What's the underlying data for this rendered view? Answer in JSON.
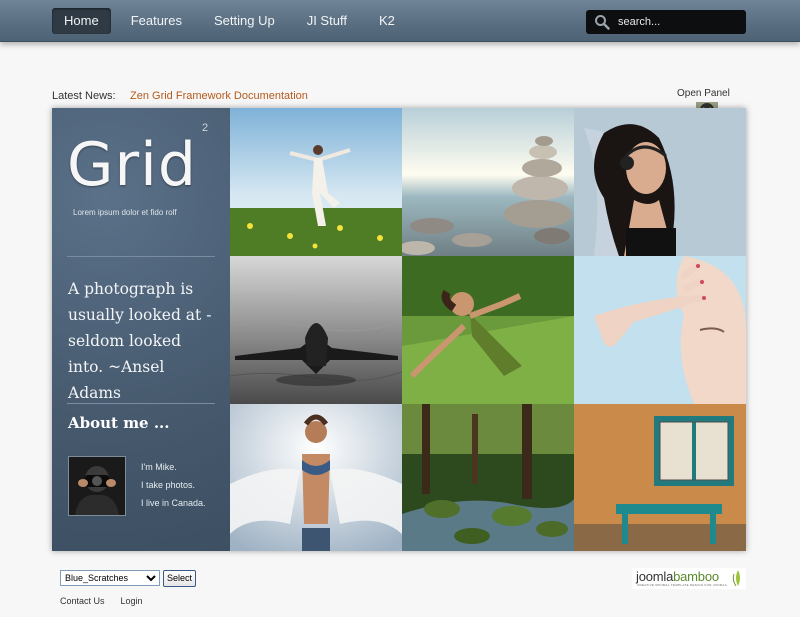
{
  "nav": {
    "items": [
      {
        "label": "Home",
        "active": true
      },
      {
        "label": "Features"
      },
      {
        "label": "Setting Up"
      },
      {
        "label": "JI Stuff"
      },
      {
        "label": "K2"
      }
    ]
  },
  "search": {
    "placeholder": "search..."
  },
  "news": {
    "label": "Latest News:",
    "headline": "Zen Grid Framework Documentation"
  },
  "panel": {
    "label": "Open Panel"
  },
  "sidebar": {
    "logo": "Grid",
    "logo_sup": "2",
    "tagline": "Lorem ipsum dolor et fido rolf",
    "quote": "A photograph is usually looked at - seldom looked into. ~Ansel Adams",
    "about_title": "About me ...",
    "about_lines": [
      "I'm Mike.",
      "I take photos.",
      "I live in Canada."
    ]
  },
  "tiles": [
    {
      "name": "dancer-meadow-photo"
    },
    {
      "name": "stacked-stones-photo"
    },
    {
      "name": "headphones-woman-photo"
    },
    {
      "name": "woman-in-water-photo"
    },
    {
      "name": "woman-arms-open-photo"
    },
    {
      "name": "face-hand-photo"
    },
    {
      "name": "woman-sky-photo"
    },
    {
      "name": "forest-stream-photo"
    },
    {
      "name": "window-bench-wall-photo"
    }
  ],
  "footer": {
    "theme_selected": "Blue_Scratches",
    "select_button": "Select",
    "links": [
      "Contact Us",
      "Login"
    ],
    "brand": {
      "first": "joomla",
      "second": "bamboo",
      "tagline": "CREATIVE MINIMAL TEMPLATE DESIGN FOR JOOMLA"
    }
  },
  "colors": {
    "accent": "#b55a1c",
    "topbar": "#5a6f82",
    "sidebar": "#46596d"
  }
}
